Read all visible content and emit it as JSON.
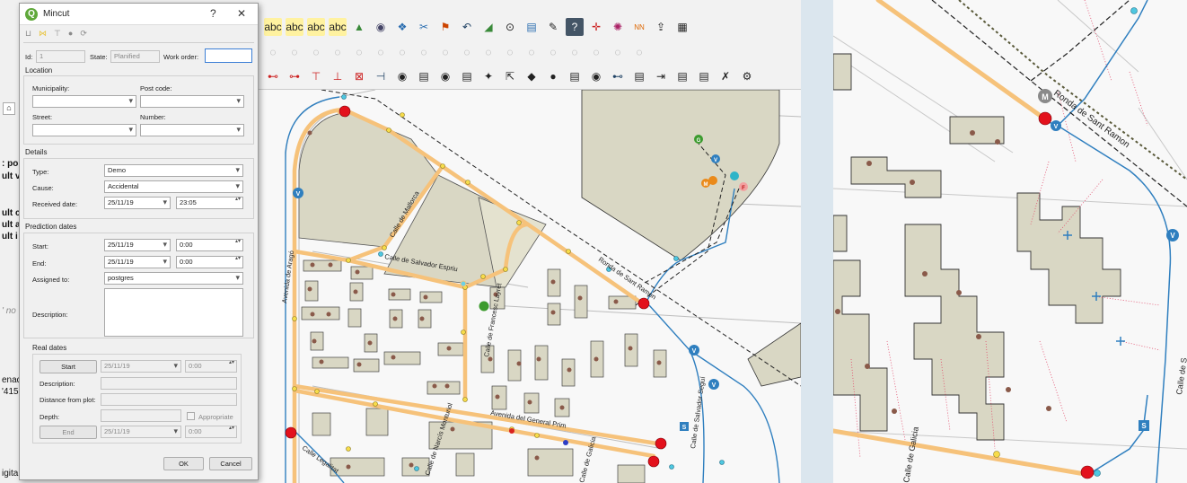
{
  "dialog": {
    "title": "Mincut",
    "help_btn": "?",
    "close_btn": "✕",
    "id_label": "Id:",
    "id_value": "1",
    "state_label": "State:",
    "state_value": "Planified",
    "work_order_label": "Work order:",
    "work_order_value": "",
    "location_section": "Location",
    "municipality_label": "Municipality:",
    "postcode_label": "Post code:",
    "street_label": "Street:",
    "number_label": "Number:",
    "details_section": "Details",
    "type_label": "Type:",
    "type_value": "Demo",
    "cause_label": "Cause:",
    "cause_value": "Accidental",
    "received_label": "Received date:",
    "received_date": "25/11/19",
    "received_time": "23:05",
    "prediction_section": "Prediction dates",
    "start_label": "Start:",
    "start_date": "25/11/19",
    "start_time": "0:00",
    "end_label": "End:",
    "end_date": "25/11/19",
    "end_time": "0:00",
    "assigned_label": "Assigned to:",
    "assigned_value": "postgres",
    "description_label": "Description:",
    "real_section": "Real dates",
    "real_start_btn": "Start",
    "real_start_date": "25/11/19",
    "real_start_time": "0:00",
    "real_desc_label": "Description:",
    "distance_label": "Distance from plot:",
    "depth_label": "Depth:",
    "appropriate_label": "Appropriate",
    "real_end_btn": "End",
    "real_end_date": "25/11/19",
    "real_end_time": "0:00",
    "ok_btn": "OK",
    "cancel_btn": "Cancel"
  },
  "left_panel": {
    "t1": ": poi",
    "t2": "ult v",
    "t3": "ult c",
    "t4": "ult a",
    "t5": "ult i",
    "t6": "' no",
    "t7": "enad",
    "t8": "'415",
    "t9": "igita"
  },
  "map_main": {
    "streets": {
      "arago": "Avenida de Aragó",
      "mallorca": "Calle de Mallorca",
      "salvador_espriu": "Calle de Salvador Espriu",
      "francesc_layret": "Calle de Francesc Layret",
      "sant_ramon": "Ronda de Sant Ramon",
      "general_prim": "Avenida del General Prim",
      "narcis_monturiol": "Calle de Narcís Monturiol",
      "galicia": "Calle de Galicia",
      "legalitat": "Calle Legalitat",
      "salvador_segui": "Calle de Salvador Seguí"
    },
    "markers": {
      "v": "V",
      "s": "S",
      "g": "G",
      "m": "M",
      "f": "F"
    }
  },
  "map_right": {
    "streets": {
      "sant_ramon": "Ronda de Sant Ramon",
      "galicia": "Calle de Galicia",
      "salvador": "Calle de S"
    },
    "markers": {
      "v": "V",
      "s": "S",
      "m": "M"
    }
  },
  "colors": {
    "pipe": "#f6c27a",
    "pipe_edge": "#e8a84c",
    "network": "#2f7fbf",
    "building": "#d9d7c4",
    "valve_red": "#e3111c",
    "connec": "#8a5a4a"
  }
}
